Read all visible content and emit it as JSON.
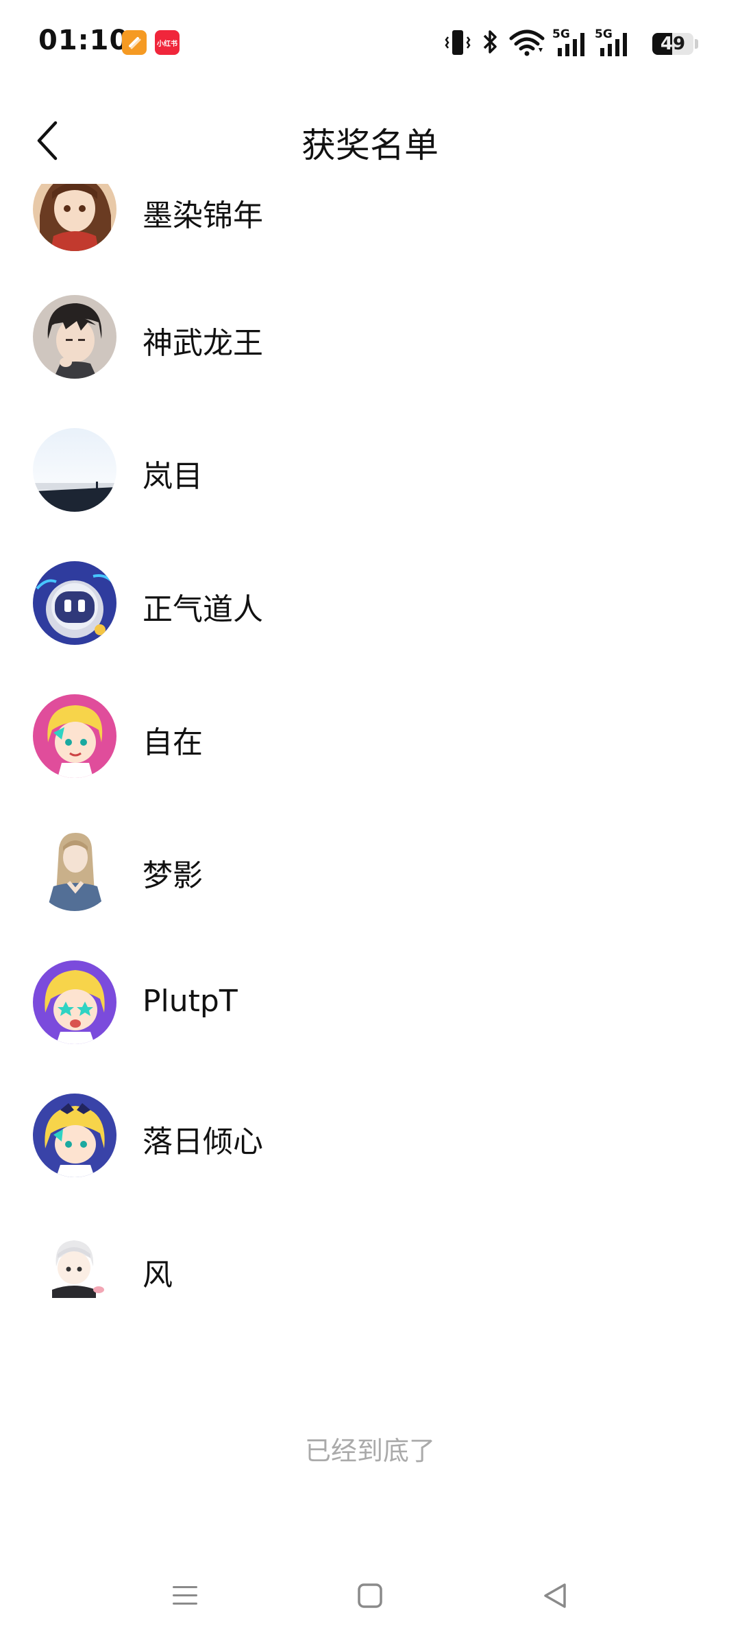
{
  "status_bar": {
    "time": "01:10",
    "app_badges": [
      "orange-app-icon",
      "xiaohongshu-icon"
    ],
    "xiaohongshu_label": "小红书",
    "network_1": "5G",
    "network_2": "5G",
    "battery_level": "49",
    "battery_fraction": 0.49,
    "icons": [
      "vibrate-icon",
      "bluetooth-icon",
      "wifi-icon",
      "signal-5g-icon",
      "signal-5g-icon",
      "battery-icon"
    ]
  },
  "header": {
    "title": "获奖名单",
    "back_icon": "chevron-left-icon"
  },
  "winners": [
    {
      "name": "墨染锦年",
      "avatar": "anime-girl-brown-hair"
    },
    {
      "name": "神武龙王",
      "avatar": "anime-boy-dark-hair"
    },
    {
      "name": "岚目",
      "avatar": "sky-sea-landscape"
    },
    {
      "name": "正气道人",
      "avatar": "robot-astronaut"
    },
    {
      "name": "自在",
      "avatar": "cartoon-blonde-pink-bg"
    },
    {
      "name": "梦影",
      "avatar": "anime-girl-long-hair"
    },
    {
      "name": "PlutpT",
      "avatar": "cartoon-blonde-purple-bg"
    },
    {
      "name": "落日倾心",
      "avatar": "cartoon-blonde-blue-bg"
    },
    {
      "name": "风",
      "avatar": "chibi-white-hair"
    }
  ],
  "footer": {
    "end_text": "已经到底了"
  },
  "nav_bar": {
    "menu_icon": "menu-icon",
    "home_icon": "home-square-icon",
    "back_icon": "back-triangle-icon"
  },
  "colors": {
    "background": "#ffffff",
    "text": "#111111",
    "muted_text": "#aaaaaa"
  }
}
